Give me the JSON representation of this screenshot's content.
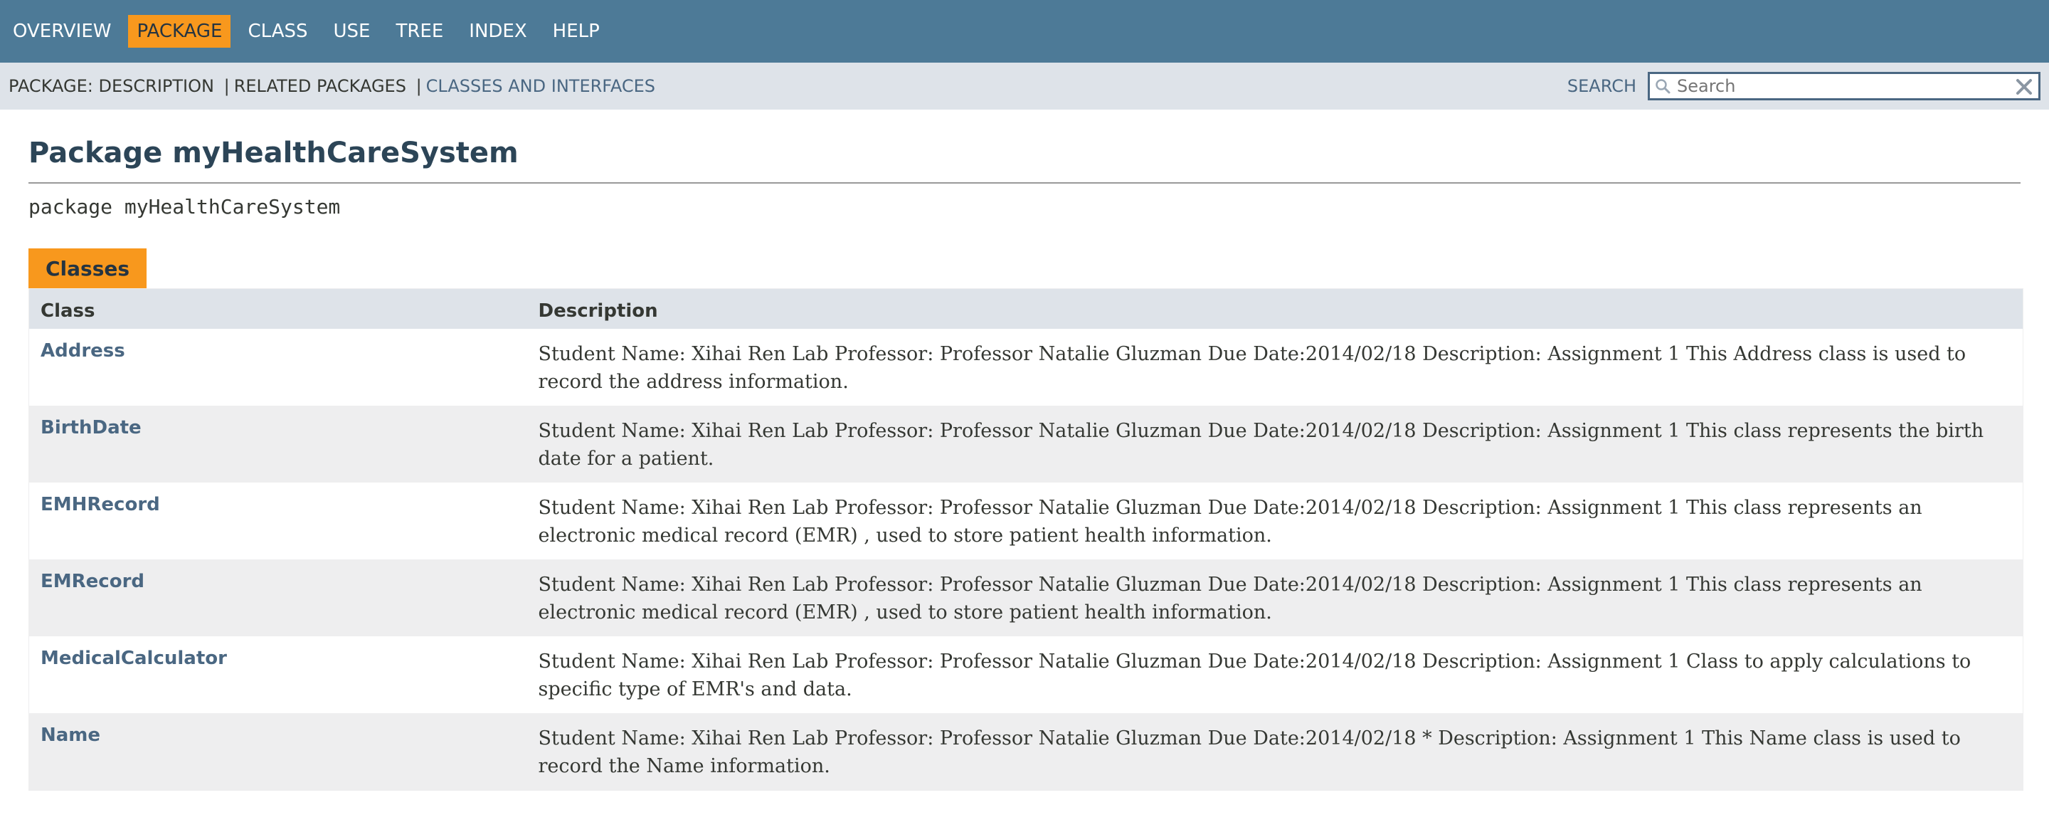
{
  "nav": {
    "items": [
      {
        "label": "OVERVIEW",
        "active": false
      },
      {
        "label": "PACKAGE",
        "active": true
      },
      {
        "label": "CLASS",
        "active": false
      },
      {
        "label": "USE",
        "active": false
      },
      {
        "label": "TREE",
        "active": false
      },
      {
        "label": "INDEX",
        "active": false
      },
      {
        "label": "HELP",
        "active": false
      }
    ]
  },
  "subnav": {
    "prefix": "PACKAGE:",
    "description": "DESCRIPTION",
    "separator": "|",
    "related": "RELATED PACKAGES",
    "classes_link": "CLASSES AND INTERFACES",
    "search_label": "SEARCH",
    "search_placeholder": "Search"
  },
  "page": {
    "title": "Package myHealthCareSystem",
    "signature": "package myHealthCareSystem",
    "tab_label": "Classes"
  },
  "table": {
    "headers": [
      "Class",
      "Description"
    ],
    "rows": [
      {
        "name": "Address",
        "description": "Student Name: Xihai Ren Lab Professor: Professor Natalie Gluzman Due Date:2014/02/18 Description: Assignment 1 This Address class is used to record the address information."
      },
      {
        "name": "BirthDate",
        "description": "Student Name: Xihai Ren Lab Professor: Professor Natalie Gluzman Due Date:2014/02/18 Description: Assignment 1 This class represents the birth date for a patient."
      },
      {
        "name": "EMHRecord",
        "description": "Student Name: Xihai Ren Lab Professor: Professor Natalie Gluzman Due Date:2014/02/18 Description: Assignment 1 This class represents an electronic medical record (EMR) , used to store patient health information."
      },
      {
        "name": "EMRecord",
        "description": "Student Name: Xihai Ren Lab Professor: Professor Natalie Gluzman Due Date:2014/02/18 Description: Assignment 1 This class represents an electronic medical record (EMR) , used to store patient health information."
      },
      {
        "name": "MedicalCalculator",
        "description": "Student Name: Xihai Ren Lab Professor: Professor Natalie Gluzman Due Date:2014/02/18 Description: Assignment 1 Class to apply calculations to specific type of EMR's and data."
      },
      {
        "name": "Name",
        "description": "Student Name: Xihai Ren Lab Professor: Professor Natalie Gluzman Due Date:2014/02/18 * Description: Assignment 1 This Name class is used to record the Name information."
      }
    ]
  },
  "icons": {
    "search": "magnifier-icon",
    "clear": "close-icon"
  },
  "colors": {
    "nav_bg": "#4d7a97",
    "active_tab": "#f8981d",
    "subnav_bg": "#dee3e9",
    "link": "#4a6782",
    "row_alt": "#eeeeef"
  }
}
